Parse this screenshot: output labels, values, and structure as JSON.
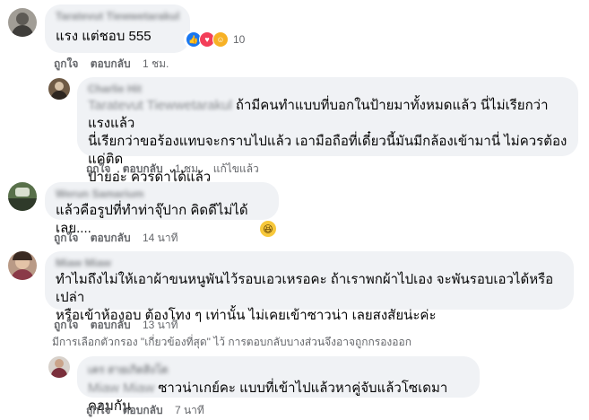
{
  "comments": [
    {
      "author": "Taratevut Tiewwetarakul",
      "text": "แรง แต่ชอบ 555",
      "reaction_count": "10",
      "like": "ถูกใจ",
      "reply": "ตอบกลับ",
      "time": "1 ชม."
    },
    {
      "author": "Charlie Hit",
      "tag": "Taratevut Tiewwetarakul",
      "lines": [
        "ถ้ามีคนทำแบบที่บอกในป้ายมาทั้งหมดแล้ว นี่ไม่เรียกว่าแรงแล้ว",
        "นี่เรียกว่าขอร้องแทบจะกราบไปแล้ว เอามือถือที่เดี๋ยวนี้มันมีกล้องเข้ามานี่ ไม่ควรต้องแค่ติด",
        "ป้ายอ่ะ ควรด่าได้แล้ว"
      ],
      "like": "ถูกใจ",
      "reply": "ตอบกลับ",
      "time": "1 ชม.",
      "edited": "แก้ไขแล้ว"
    },
    {
      "author": "Werun Samarium",
      "text": "แล้วคือรูปที่ทำท่าจุ๊ปาก คิดดีไม่ได้เลย....",
      "emoji": "laughing-emoji",
      "like": "ถูกใจ",
      "reply": "ตอบกลับ",
      "time": "14 นาที"
    },
    {
      "author": "Miaw Miaw",
      "lines": [
        "ทำไมถึงไม่ให้เอาผ้าขนหนูพันไว้รอบเอวเหรอคะ ถ้าเราพกผ้าไปเอง จะพันรอบเอวได้หรือเปล่า",
        "หรือเข้าห้องอบ ต้องโทง ๆ เท่านั้น ไม่เคยเข้าซาวน่า เลยสงสัยน่ะค่ะ"
      ],
      "like": "ถูกใจ",
      "reply": "ตอบกลับ",
      "time": "13 นาที"
    },
    {
      "author": "เคร สายเกิดสิงโต",
      "tag": "Miaw Miaw",
      "text": "ซาวน่าเกย์คะ แบบที่เข้าไปแล้วหาคู่จับแล้วโซเดมาคอมกัน",
      "like": "ถูกใจ",
      "reply": "ตอบกลับ",
      "time": "7 นาที"
    }
  ],
  "filter_note": "มีการเลือกตัวกรอง \"เกี่ยวข้องที่สุด\" ไว้ การตอบกลับบางส่วนจึงอาจถูกกรองออก",
  "reaction_icons": [
    "like-icon",
    "love-icon",
    "care-icon"
  ],
  "colors": {
    "like": "#1877f2",
    "love": "#f33e58",
    "care": "#f7b125",
    "bubble": "#f0f2f5",
    "meta": "#65676b"
  }
}
